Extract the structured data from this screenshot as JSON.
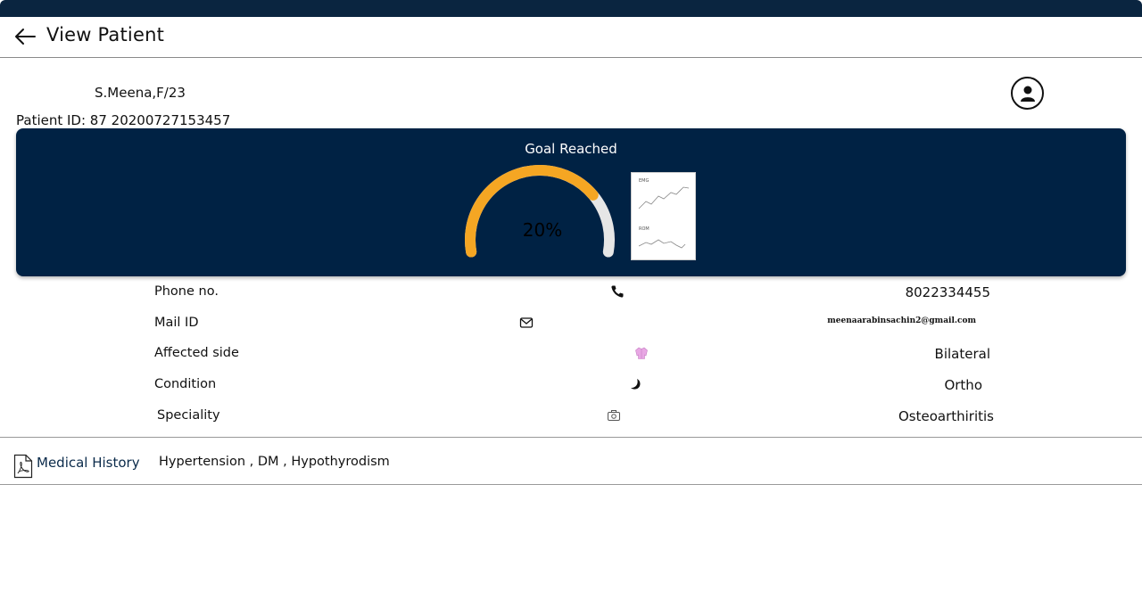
{
  "header": {
    "title": "View Patient",
    "back_icon": "arrow-left-icon"
  },
  "patient": {
    "name_line": "S.Meena,F/23",
    "id_line": "Patient ID: 87 20200727153457",
    "avatar_icon": "user-circle-icon"
  },
  "goal": {
    "title": "Goal Reached",
    "percent_label": "20%",
    "progress_fraction": 0.2,
    "mini_chart": {
      "emg_label": "EMG",
      "rom_label": "ROM"
    }
  },
  "info": [
    {
      "label": "Phone no.",
      "icon": "phone-icon",
      "value": "8022334455"
    },
    {
      "label": "Mail ID",
      "icon": "mail-icon",
      "value": "meenaarabinsachin2@gmail.com"
    },
    {
      "label": "Affected side",
      "icon": "shirt-icon",
      "value": "Bilateral"
    },
    {
      "label": "Condition",
      "icon": "moon-icon",
      "value": "Ortho"
    },
    {
      "label": "Speciality",
      "icon": "camera-icon",
      "value": "Osteoarthiritis"
    }
  ],
  "medical_history": {
    "label": "Medical History",
    "icon": "pdf-file-icon",
    "value": "Hypertension , DM , Hypothyrodism"
  },
  "colors": {
    "navy": "#002244",
    "gauge_orange": "#f5a623",
    "gauge_track": "#e6e6e6"
  }
}
